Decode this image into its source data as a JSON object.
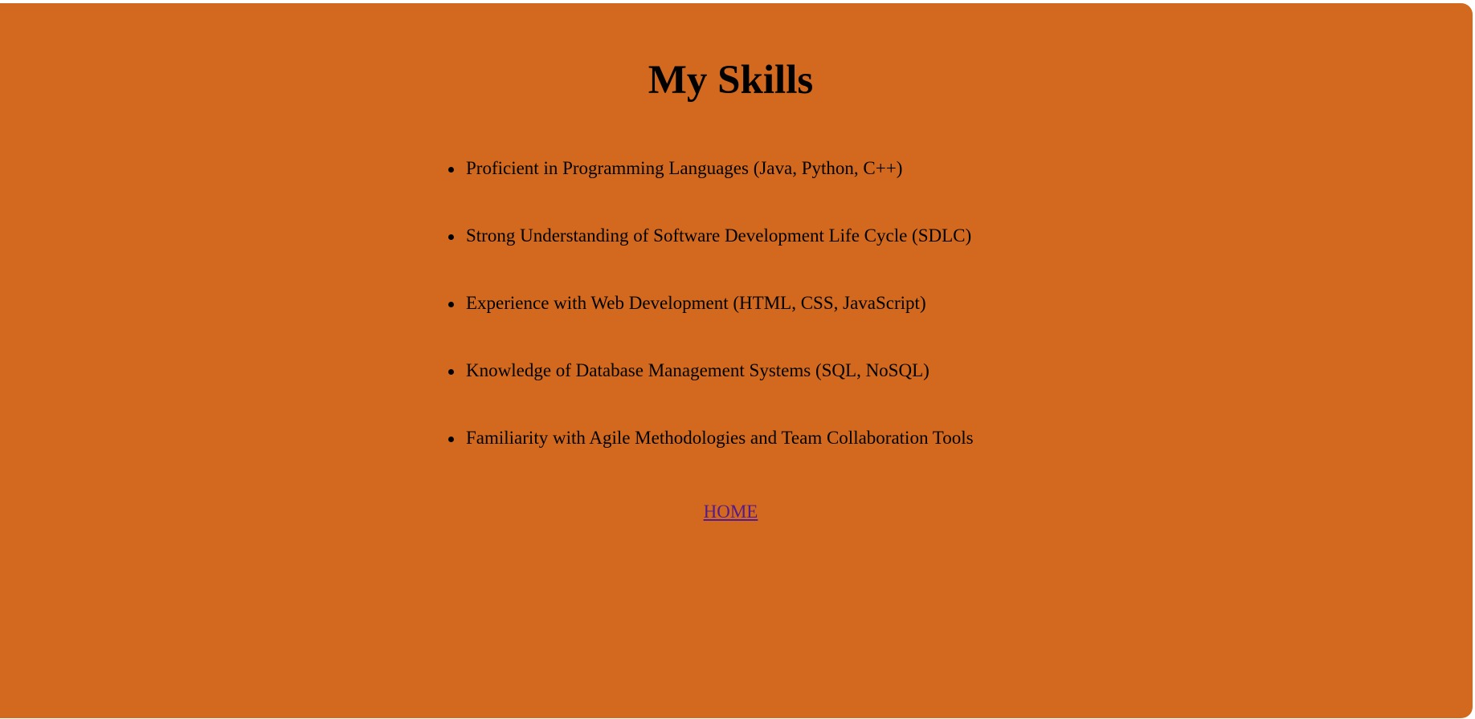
{
  "page": {
    "title": "My Skills",
    "background_color": "#d2691e",
    "link_color": "#551a8b"
  },
  "skills": [
    "Proficient in Programming Languages (Java, Python, C++)",
    "Strong Understanding of Software Development Life Cycle (SDLC)",
    "Experience with Web Development (HTML, CSS, JavaScript)",
    "Knowledge of Database Management Systems (SQL, NoSQL)",
    "Familiarity with Agile Methodologies and Team Collaboration Tools"
  ],
  "nav": {
    "home_label": "HOME"
  }
}
